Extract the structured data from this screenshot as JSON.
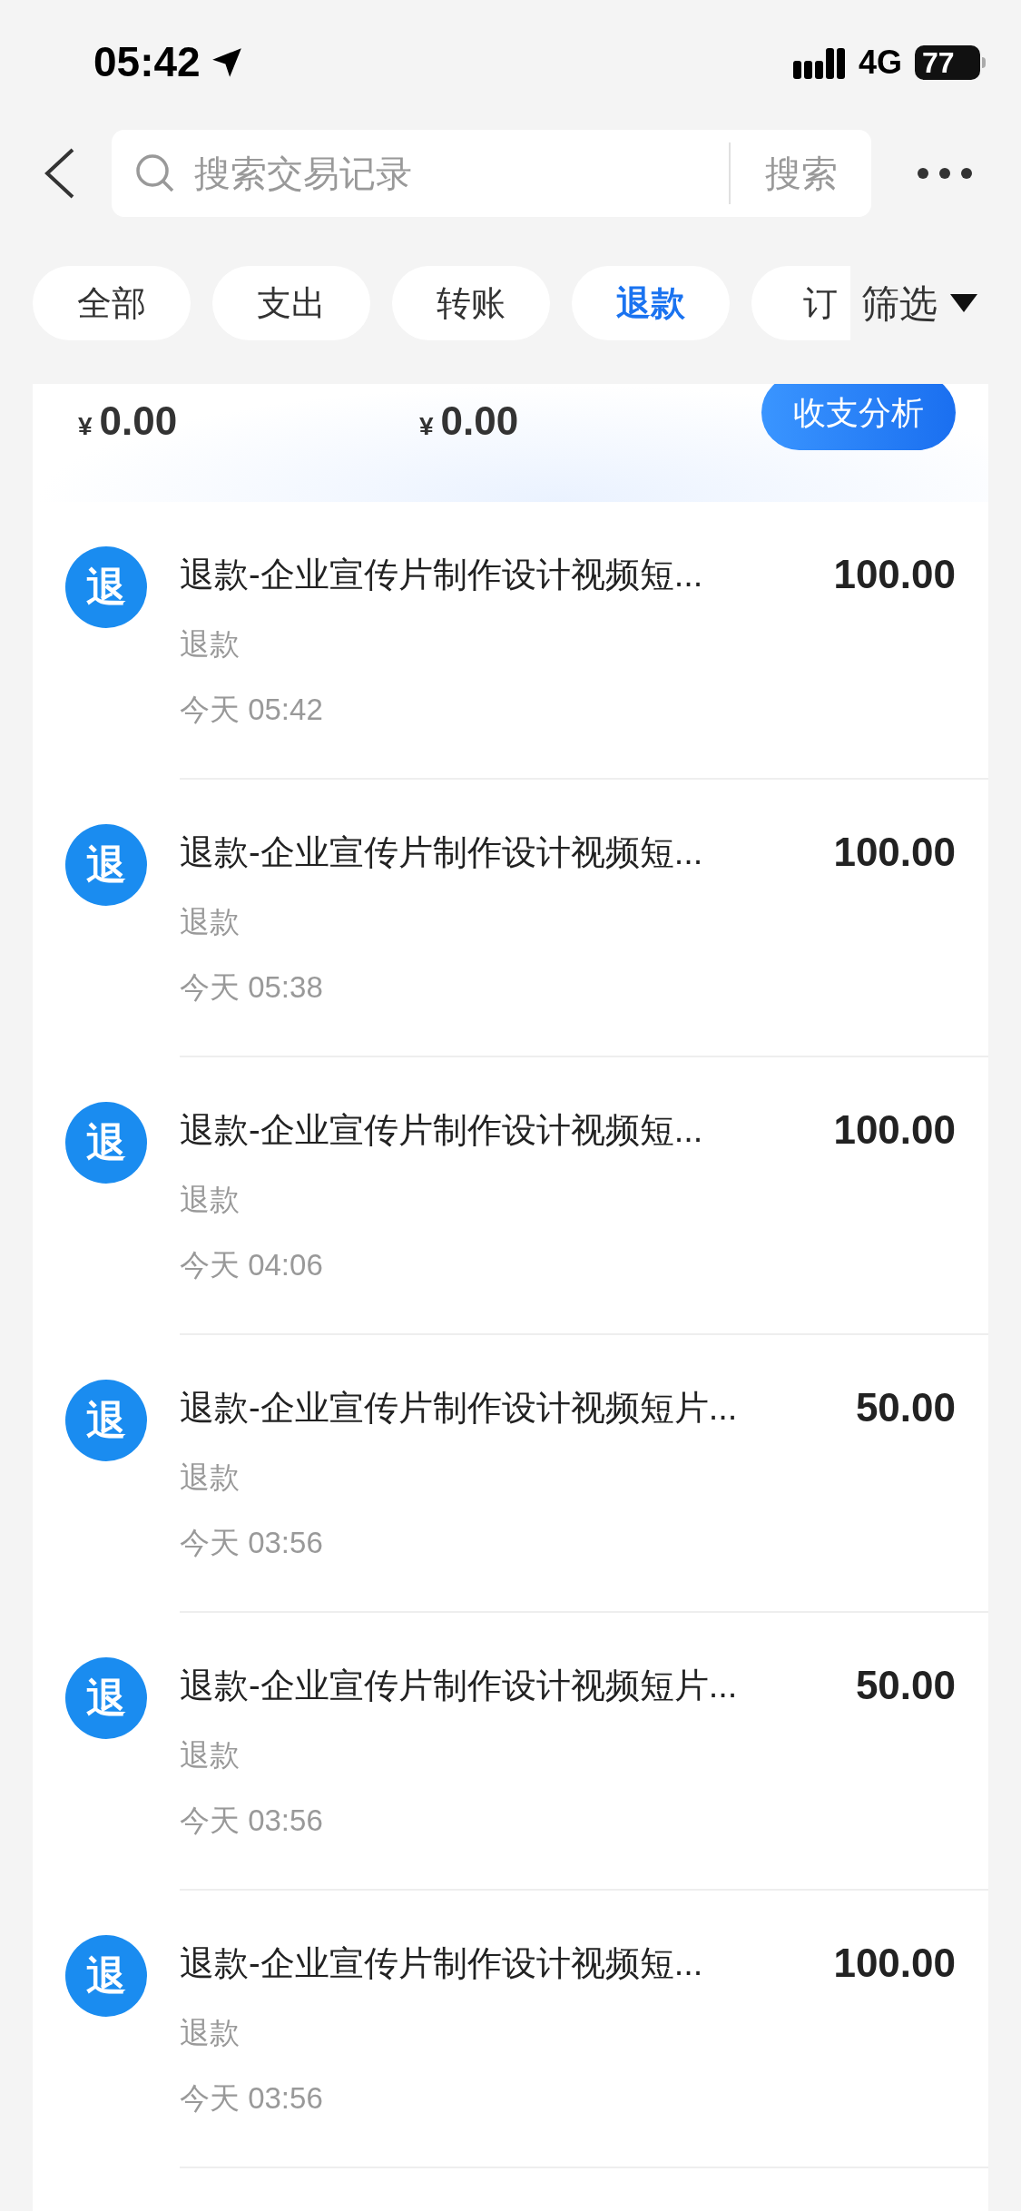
{
  "status_bar": {
    "time": "05:42",
    "network": "4G",
    "battery": "77"
  },
  "search": {
    "placeholder": "搜索交易记录",
    "button": "搜索"
  },
  "tabs": [
    {
      "label": "全部",
      "selected": false
    },
    {
      "label": "支出",
      "selected": false
    },
    {
      "label": "转账",
      "selected": false
    },
    {
      "label": "退款",
      "selected": true
    },
    {
      "label": "订",
      "selected": false
    }
  ],
  "filter": "筛选",
  "summary": {
    "amounts": [
      {
        "currency": "¥",
        "value": "0.00"
      },
      {
        "currency": "¥",
        "value": "0.00"
      }
    ],
    "analysis_button": "收支分析"
  },
  "transactions": [
    {
      "icon": "退",
      "title": "退款-企业宣传片制作设计视频短...",
      "type": "退款",
      "time": "今天 05:42",
      "amount": "100.00"
    },
    {
      "icon": "退",
      "title": "退款-企业宣传片制作设计视频短...",
      "type": "退款",
      "time": "今天 05:38",
      "amount": "100.00"
    },
    {
      "icon": "退",
      "title": "退款-企业宣传片制作设计视频短...",
      "type": "退款",
      "time": "今天 04:06",
      "amount": "100.00"
    },
    {
      "icon": "退",
      "title": "退款-企业宣传片制作设计视频短片...",
      "type": "退款",
      "time": "今天 03:56",
      "amount": "50.00"
    },
    {
      "icon": "退",
      "title": "退款-企业宣传片制作设计视频短片...",
      "type": "退款",
      "time": "今天 03:56",
      "amount": "50.00"
    },
    {
      "icon": "退",
      "title": "退款-企业宣传片制作设计视频短...",
      "type": "退款",
      "time": "今天 03:56",
      "amount": "100.00"
    }
  ]
}
